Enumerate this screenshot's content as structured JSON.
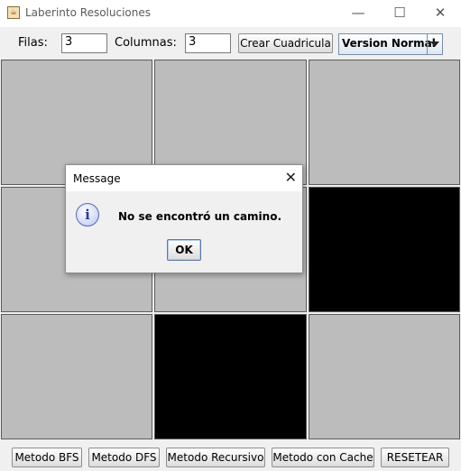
{
  "window": {
    "title": "Laberinto Resoluciones",
    "minimize_glyph": "—",
    "maximize_glyph": "☐",
    "close_glyph": "✕"
  },
  "toolbar": {
    "filas_label": "Filas:",
    "filas_value": "3",
    "columnas_label": "Columnas:",
    "columnas_value": "3",
    "create_button": "Crear Cuadricula",
    "version_select": "Version Normal"
  },
  "grid": {
    "rows": 3,
    "cols": 3,
    "cells": [
      [
        "empty",
        "empty",
        "empty"
      ],
      [
        "empty",
        "empty",
        "wall"
      ],
      [
        "empty",
        "wall",
        "empty"
      ]
    ],
    "colors": {
      "empty": "#bcbcbc",
      "wall": "#000000"
    }
  },
  "bottom": {
    "bfs": "Metodo BFS",
    "dfs": "Metodo DFS",
    "recursive": "Metodo Recursivo",
    "cache": "Metodo con Cache",
    "reset": "RESETEAR"
  },
  "dialog": {
    "title": "Message",
    "message": "No se encontró un camino.",
    "ok": "OK",
    "icon": "info-icon",
    "close_glyph": "✕",
    "icon_glyph": "i"
  }
}
